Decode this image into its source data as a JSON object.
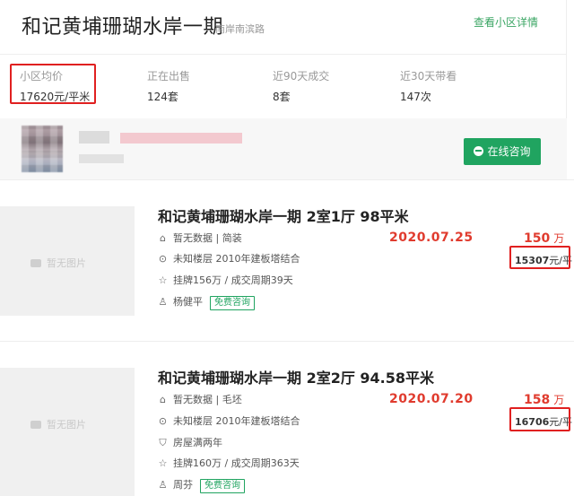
{
  "header": {
    "title": "和记黄埔珊瑚水岸一期",
    "subtitle": "南岸南滨路",
    "detail_link": "查看小区详情",
    "stats": [
      {
        "label": "小区均价",
        "value": "17620元/平米"
      },
      {
        "label": "正在出售",
        "value": "124套"
      },
      {
        "label": "近90天成交",
        "value": "8套"
      },
      {
        "label": "近30天带看",
        "value": "147次"
      }
    ],
    "consult_button": "在线咨询"
  },
  "listings": [
    {
      "title": "和记黄埔珊瑚水岸一期 2室1厅 98平米",
      "no_image": "暂无图片",
      "decor": "暂无数据 | 简装",
      "floor": "未知楼层 2010年建板塔结合",
      "listing_info": "挂牌156万 / 成交周期39天",
      "agent": "杨健平",
      "consult_tag": "免费咨询",
      "deal_date": "2020.07.25",
      "price": "150",
      "price_unit": "万",
      "unit_price_num": "15307",
      "unit_price_unit": "元/平"
    },
    {
      "title": "和记黄埔珊瑚水岸一期 2室2厅 94.58平米",
      "no_image": "暂无图片",
      "decor": "暂无数据 | 毛坯",
      "floor": "未知楼层 2010年建板塔结合",
      "ownership": "房屋满两年",
      "listing_info": "挂牌160万 / 成交周期363天",
      "agent": "周芬",
      "consult_tag": "免费咨询",
      "deal_date": "2020.07.20",
      "price": "158",
      "price_unit": "万",
      "unit_price_num": "16706",
      "unit_price_unit": "元/平"
    }
  ],
  "colors": {
    "accent": "#20a460",
    "price": "#e03b2e",
    "highlight_box": "#e02020"
  },
  "icons": [
    "home-icon",
    "location-icon",
    "star-icon",
    "user-icon",
    "shield-icon",
    "camera-icon",
    "chat-icon"
  ]
}
